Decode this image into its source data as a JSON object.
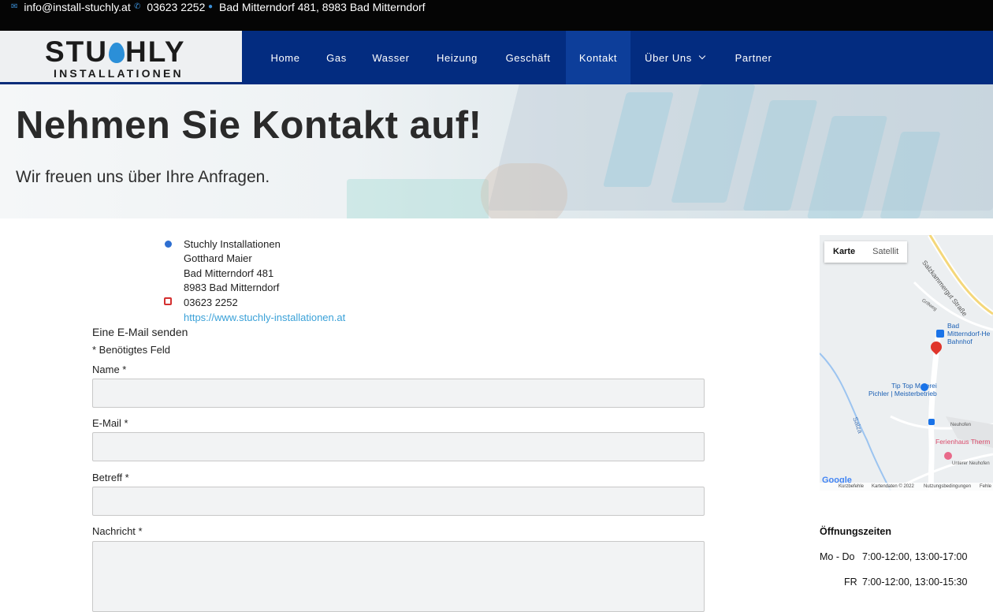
{
  "topbar": {
    "email": "info@install-stuchly.at",
    "phone": "03623 2252",
    "address": "Bad Mitterndorf 481, 8983 Bad Mitterndorf",
    "icon_color": "#3b8fd6"
  },
  "logo": {
    "top_left": "STU",
    "top_right": "HLY",
    "bottom": "INSTALLATIONEN"
  },
  "nav": {
    "items": [
      {
        "label": "Home"
      },
      {
        "label": "Gas"
      },
      {
        "label": "Wasser"
      },
      {
        "label": "Heizung"
      },
      {
        "label": "Geschäft"
      },
      {
        "label": "Kontakt"
      },
      {
        "label": "Über Uns"
      },
      {
        "label": "Partner"
      }
    ],
    "active": "Kontakt",
    "background": "#032c80"
  },
  "hero": {
    "title": "Nehmen Sie Kontakt auf!",
    "subtitle": "Wir freuen uns über Ihre Anfragen."
  },
  "contact": {
    "company": "Stuchly Installationen",
    "person": "Gotthard Maier",
    "street": "Bad Mitterndorf 481",
    "city": "8983 Bad Mitterndorf",
    "phone": "03623 2252",
    "website": "https://www.stuchly-installationen.at"
  },
  "form": {
    "heading": "Eine E-Mail senden",
    "required_note": "* Benötigtes Feld",
    "fields": [
      {
        "label": "Name *",
        "value": ""
      },
      {
        "label": "E-Mail *",
        "value": ""
      },
      {
        "label": "Betreff *",
        "value": ""
      },
      {
        "label": "Nachricht *",
        "value": ""
      }
    ]
  },
  "map": {
    "tabs": [
      "Karte",
      "Satellit"
    ],
    "labels": {
      "road": "Salzkammergut Straße",
      "grillweg": "Grillweg",
      "station": "Bad Mitterndorf-Heilbr... Bahnhof",
      "station_line1": "Bad",
      "station_line2": "Mitterndorf-He",
      "station_line3": "Bahnhof",
      "painter_line1": "Tip Top Malerei",
      "painter_line2": "Pichler | Meisterbetrieb",
      "river": "Salza",
      "holiday": "Ferienhaus Therm",
      "neuhofen": "Neuhofen",
      "unterer": "Unterer Neuhofen"
    },
    "footer": [
      "Kurzbefehle",
      "Kartendaten © 2022",
      "Nutzungsbedingungen",
      "Fehle"
    ],
    "google": "Google"
  },
  "opening_hours": {
    "title": "Öffnungszeiten",
    "rows": [
      {
        "day": "Mo - Do",
        "time": "7:00-12:00, 13:00-17:00"
      },
      {
        "day": "FR",
        "time": "7:00-12:00, 13:00-15:30"
      }
    ]
  }
}
